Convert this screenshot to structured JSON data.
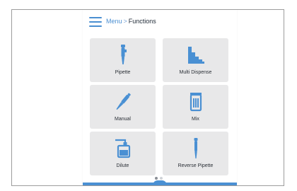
{
  "header": {
    "menu_icon": "hamburger-menu-icon",
    "breadcrumb_link": "Menu",
    "breadcrumb_separator": ">",
    "breadcrumb_current": "Functions"
  },
  "functions": [
    {
      "label": "Pipette",
      "icon": "pipette-icon"
    },
    {
      "label": "Multi Dispense",
      "icon": "multi-dispense-icon"
    },
    {
      "label": "Manual",
      "icon": "manual-pipette-icon"
    },
    {
      "label": "Mix",
      "icon": "mix-icon"
    },
    {
      "label": "Dilute",
      "icon": "dilute-icon"
    },
    {
      "label": "Reverse Pipette",
      "icon": "reverse-pipette-icon"
    }
  ],
  "pager": {
    "pages": 2,
    "current": 1
  },
  "colors": {
    "accent": "#4a90d3",
    "tile": "#e8e8e9",
    "text": "#2a2f36"
  }
}
